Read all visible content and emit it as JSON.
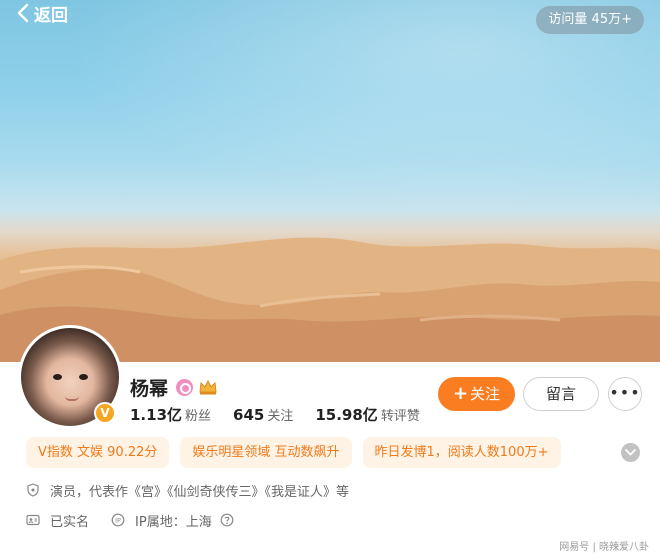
{
  "header": {
    "back_label": "返回",
    "visits_label": "访问量 45万+"
  },
  "profile": {
    "name": "杨幂",
    "verified_mark": "V",
    "stats": {
      "followers_value": "1.13亿",
      "followers_label": "粉丝",
      "following_value": "645",
      "following_label": "关注",
      "likes_value": "15.98亿",
      "likes_label": "转评赞"
    }
  },
  "actions": {
    "follow_plus": "+",
    "follow_label": "关注",
    "message_label": "留言",
    "more_label": "•••"
  },
  "chips": [
    {
      "label": "V指数 文娱 90.22分"
    },
    {
      "label": "娱乐明星领域 互动数飙升"
    },
    {
      "label": "昨日发博1，阅读人数100万+"
    }
  ],
  "info": {
    "bio": "演员，代表作《宫》《仙剑奇侠传三》《我是证人》等",
    "verified_real_name": "已实名",
    "ip_location": "IP属地：上海"
  },
  "watermark": "网易号 | 晓辣爱八卦",
  "colors": {
    "accent": "#fa7d22",
    "chip_bg": "#fff3e6",
    "chip_text": "#f07a1a"
  },
  "icons": {
    "back": "chevron-left-icon",
    "more": "more-dots-icon",
    "expand": "chevron-down-icon",
    "bio": "shield-icon",
    "real_name": "id-card-icon",
    "ip": "ip-location-icon",
    "help": "question-icon"
  }
}
